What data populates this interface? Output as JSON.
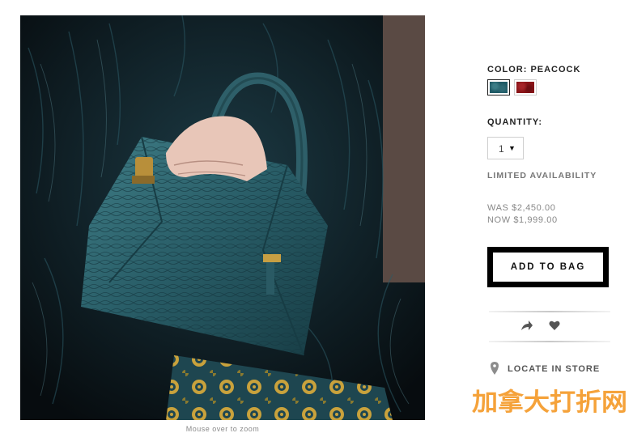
{
  "product": {
    "image_alt": "Peacock python leather satchel handbag held against dark fur coat",
    "zoom_hint": "Mouse over to zoom"
  },
  "options": {
    "color_label": "COLOR: PEACOCK",
    "swatches": [
      {
        "name": "peacock",
        "color": "#1f5a66",
        "selected": true
      },
      {
        "name": "red",
        "color": "#8a1418",
        "selected": false
      }
    ],
    "quantity_label": "QUANTITY:",
    "quantity_value": "1",
    "availability": "LIMITED AVAILABILITY"
  },
  "pricing": {
    "was": "WAS $2,450.00",
    "now": "NOW $1,999.00"
  },
  "actions": {
    "add_to_bag": "ADD TO BAG",
    "share_icon": "share-arrow-icon",
    "wishlist_icon": "heart-icon",
    "locate_in_store": "LOCATE IN STORE",
    "locate_icon": "map-pin-icon"
  },
  "watermark": {
    "text": "加拿大打折网",
    "color": "#f5a23a"
  }
}
